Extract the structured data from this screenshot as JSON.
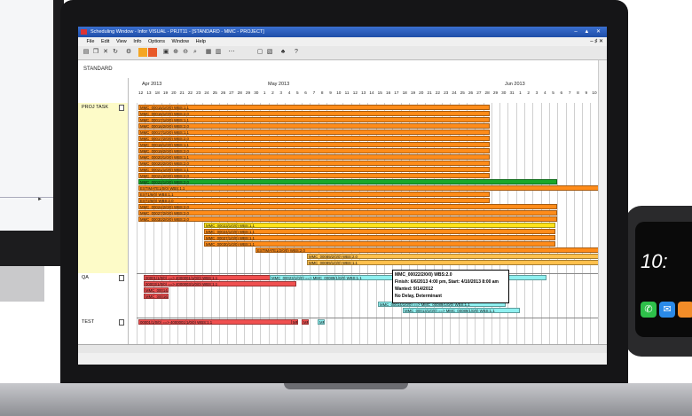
{
  "window": {
    "title": "Scheduling Window - Infor VISUAL - PRJT11 - [STANDARD - MMC - PROJECT]",
    "controls": [
      "–",
      "▲",
      "✕"
    ]
  },
  "menu": [
    "File",
    "Edit",
    "View",
    "Info",
    "Options",
    "Window",
    "Help"
  ],
  "menu_controls": "– ♯ ✕",
  "view_name": "STANDARD",
  "timeline": {
    "months": [
      "Apr 2013",
      "May 2013",
      "Jun 2013"
    ],
    "days": [
      "12",
      "13",
      "18",
      "19",
      "20",
      "21",
      "22",
      "23",
      "24",
      "25",
      "26",
      "27",
      "28",
      "29",
      "30",
      "1",
      "2",
      "3",
      "4",
      "5",
      "6",
      "7",
      "8",
      "9",
      "10",
      "11",
      "12",
      "13",
      "14",
      "15",
      "16",
      "17",
      "18",
      "19",
      "20",
      "21",
      "22",
      "23",
      "24",
      "25",
      "26",
      "27",
      "28",
      "29",
      "30",
      "31",
      "1",
      "2",
      "3",
      "4",
      "5",
      "6",
      "7",
      "8",
      "9",
      "10",
      "11"
    ]
  },
  "rows": [
    {
      "label": "PROJ TASK"
    },
    {
      "label": "QA"
    },
    {
      "label": "TEST"
    }
  ],
  "bars": [
    {
      "text": "MMC_00015/1/0/0) WBS:1.1",
      "color": "#ff8c1a"
    },
    {
      "text": "MMC_00016/1/0/0) WBS:2.0",
      "color": "#ff8c1a"
    },
    {
      "text": "MMC_00017/1/0/0) WBS:1.1",
      "color": "#ff8c1a"
    },
    {
      "text": "MMC_00016/2/0/0) WBS:2.0",
      "color": "#ff8c1a"
    },
    {
      "text": "MMC_00017/1/0/0) WBS:1.1",
      "color": "#ff8c1a"
    },
    {
      "text": "MMC_00017/2/0/0) WBS:2.0",
      "color": "#ff8c1a"
    },
    {
      "text": "MMC_00018/1/0/0) WBS:1.1",
      "color": "#ff8c1a"
    },
    {
      "text": "MMC_00019/2/0/0) WBS:2.0",
      "color": "#ff8c1a"
    },
    {
      "text": "MMC_00020/1/0/0) WBS:1.1",
      "color": "#ff8c1a"
    },
    {
      "text": "MMC_00020/2/0/0) WBS:2.0",
      "color": "#ff8c1a"
    },
    {
      "text": "MMC_00021/1/0/0) WBS:1.1",
      "color": "#ff8c1a"
    },
    {
      "text": "MMC_00021/2/0/0) WBS:2.0",
      "color": "#ff8c1a"
    },
    {
      "text": "MMC_00022/1/0/0) WBS:2.0",
      "color": "#1aa82a"
    },
    {
      "text": "ESTIMATE1/0/0) WBS:1.1",
      "color": "#ff8c1a"
    },
    {
      "text": "EST1/8/0) WBS:1.1",
      "color": "#ff8c1a"
    },
    {
      "text": "EST2/8/0) WBS:2.0",
      "color": "#ff8c1a"
    },
    {
      "text": "MMC_00024/2/0/0) WBS:2.0",
      "color": "#ff8c1a"
    },
    {
      "text": "MMC_00027/2/0/0) WBS:2.0",
      "color": "#ff8c1a"
    },
    {
      "text": "MMC_00030/2/0/0) WBS:2.0",
      "color": "#ff8c1a"
    },
    {
      "text": "MMC_00023/1/0/0) WBS:1.1",
      "color": "#ffe21a"
    },
    {
      "text": "MMC_00024/1/0/0) WBS:1.1",
      "color": "#ff8c1a"
    },
    {
      "text": "MMC_00027/1/0/0) WBS:1.1",
      "color": "#ff8c1a"
    },
    {
      "text": "MMC_00030/1/0/0) WBS:1.1",
      "color": "#ff8c1a"
    },
    {
      "text": "ESTIMATE1/2/0/0) WBS:2.0",
      "color": "#ff8c1a"
    },
    {
      "text": "MMC_00089/2/0/0) WBS:2.0",
      "color": "#ffc04d"
    },
    {
      "text": "MMC_00089/1/0/0) WBS:1.1",
      "color": "#ffc04d"
    },
    {
      "text": "00001/1/0/0) ==> 4000001/1/0/0) WBS:1.1",
      "color": "#f05050"
    },
    {
      "text": "00003/1/0/0) ==> 4000003/1/0/0) WBS:1.1",
      "color": "#f05050"
    },
    {
      "text": "MMC_00023/1/0/0) ==> MMC_00089/1/0/0) WBS:1.1",
      "color": "#8ff0f0"
    },
    {
      "text": "MMC_00014/",
      "color": "#f05050"
    },
    {
      "text": "MMC_00016/",
      "color": "#f05050"
    },
    {
      "text": "MMC_00014/1/0/0) ==> MMC_00089/1/0/0) WBS:1.1",
      "color": "#8ff0f0"
    },
    {
      "text": "MMC_00013/1/0/0) ==> MMC_00089/1/0/0) WBS:1.1",
      "color": "#8ff0f0"
    },
    {
      "text": "00001/1/0/0) ==> 4000001/1/0/0) WBS:1.1",
      "color": "#f05050"
    },
    {
      "text": "MMC",
      "color": "#f05050"
    },
    {
      "text": "MMC",
      "color": "#f05050"
    },
    {
      "text": "MMC_00010/1/0/0) ==> MMC_00089/1/0/0) WBS:1.1",
      "color": "#8ff0f0"
    }
  ],
  "tooltip": {
    "line1": "MMC_00022/2/0/0) WBS:2.0",
    "line2": "Finish: 6/6/2013 4:00 pm, Start: 4/10/2013 8:00 am",
    "line3": "Wanted: 9/14/2012",
    "line4": "No Delay, Determinant"
  },
  "watch": {
    "time": "10:"
  }
}
